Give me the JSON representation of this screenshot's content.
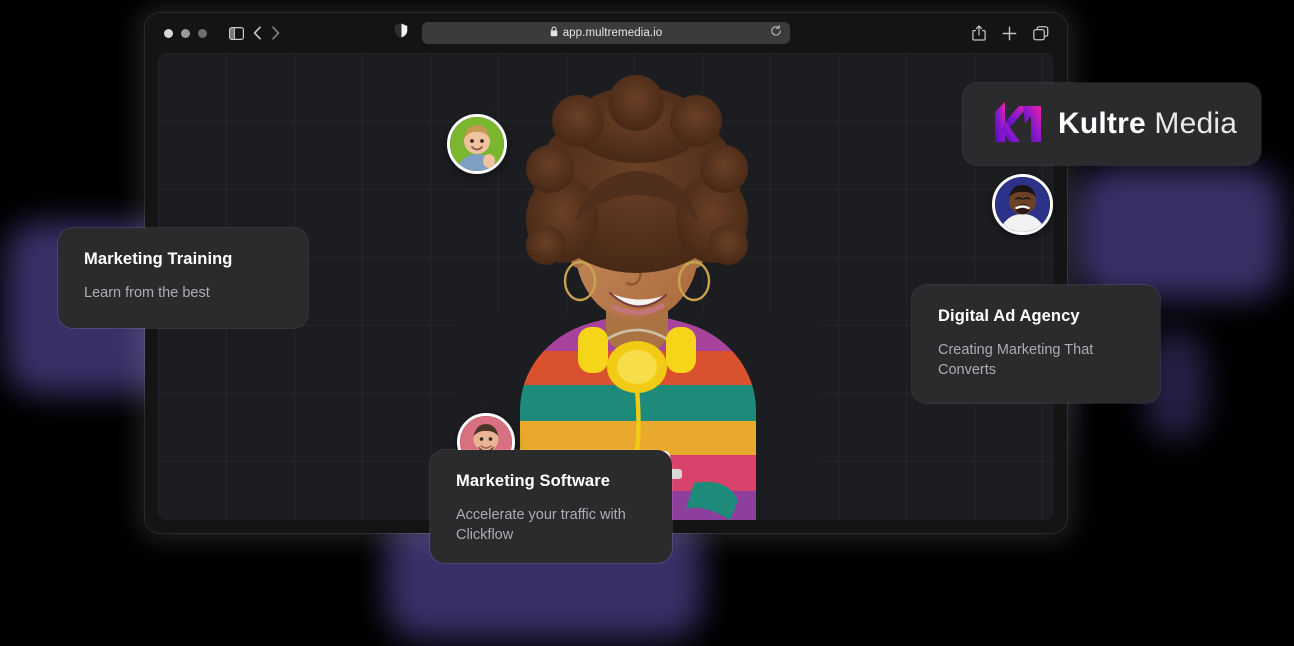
{
  "browser": {
    "url": "app.multremedia.io",
    "lock_icon": "lock-icon",
    "traffic_lights": [
      "close-dot",
      "minimize-dot",
      "maximize-dot"
    ],
    "toolbar_icons": [
      "sidebar-toggle-icon",
      "back-chevron-icon",
      "forward-chevron-icon",
      "shield-privacy-icon",
      "reload-icon",
      "share-icon",
      "new-tab-icon",
      "tab-overview-icon"
    ]
  },
  "brand": {
    "logo_icon": "kultre-monogram-icon",
    "name_bold": "Kultre",
    "name_light": "Media",
    "gradient_start": "#5b16c8",
    "gradient_end": "#e81ba6"
  },
  "hero": {
    "alt": "smiling-woman-with-headphones-at-laptop",
    "skin": "#b9794b",
    "hair": "#5a3520",
    "headphones": "#f5d51a",
    "sweater_stripes": [
      "#a8439c",
      "#d9512d",
      "#1e8a7a",
      "#e8a92c",
      "#d9426b",
      "#8e3f9e"
    ]
  },
  "avatars": [
    {
      "name": "avatar-member-1",
      "background": "#7bb72e",
      "shirt": "#7f9fc4",
      "hair": "#c49a52",
      "skin": "#f0c2a0"
    },
    {
      "name": "avatar-member-2",
      "background": "#2b3287",
      "shirt": "#f2f2f2",
      "hair": "#1b1410",
      "skin": "#6b4228"
    },
    {
      "name": "avatar-member-3",
      "background": "#d9707f",
      "shirt": "#9aa7b8",
      "hair": "#4a3527",
      "skin": "#e8b493"
    }
  ],
  "cards": [
    {
      "id": "marketing-training",
      "title": "Marketing Training",
      "subtitle": "Learn from the best"
    },
    {
      "id": "digital-ad-agency",
      "title": "Digital Ad Agency",
      "subtitle": "Creating Marketing That Converts"
    },
    {
      "id": "marketing-software",
      "title": "Marketing Software",
      "subtitle": "Accelerate your traffic with Clickflow"
    }
  ],
  "theme": {
    "page_background": "#000000",
    "window_background": "#141414",
    "canvas_background": "#1c1d21",
    "card_background": "#2b2b2d",
    "glow_color": "#5b4fa8",
    "title_color": "#ffffff",
    "subtitle_color": "#acacb2"
  }
}
